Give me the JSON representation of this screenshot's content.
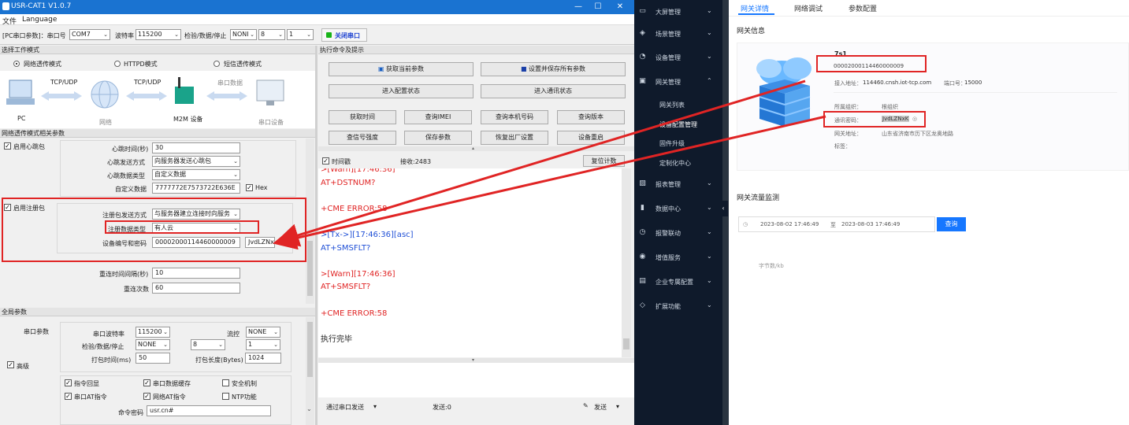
{
  "app": {
    "title": "USR-CAT1 V1.0.7",
    "menu": [
      "文件",
      "Language"
    ],
    "toolbar": {
      "pc_label": "[PC串口参数]：串口号",
      "port": "COM7",
      "baud_label": "波特率",
      "baud": "115200",
      "check_label": "检验/数据/停止",
      "parity": "NONI",
      "databits": "8",
      "stopbits": "1",
      "close_port": "关闭串口"
    },
    "mode_section": "选择工作模式",
    "modes": [
      "网络透传模式",
      "HTTPD模式",
      "短信透传模式"
    ],
    "diagram": {
      "tcp1": "TCP/UDP",
      "tcp2": "TCP/UDP",
      "serial_data": "串口数据",
      "pc": "PC",
      "network": "网络",
      "m2m": "M2M 设备",
      "serial_dev": "串口设备"
    },
    "net_section": "网络透传模式相关参数",
    "heartbeat": {
      "enable": "启用心跳包",
      "interval_label": "心跳时间(秒)",
      "interval": "30",
      "send_label": "心跳发送方式",
      "send": "向服务器发送心跳包",
      "type_label": "心跳数据类型",
      "type": "自定义数据",
      "data_label": "自定义数据",
      "data": "7777772E7573722E636E",
      "hex": "Hex"
    },
    "register": {
      "enable": "启用注册包",
      "send_label": "注册包发送方式",
      "send": "与服务器建立连接时向服务",
      "type_label": "注册数据类型",
      "type": "有人云",
      "id_label": "设备编号和密码",
      "id": "00002000114460000009",
      "pwd": "JvdLZNxK"
    },
    "reconnect_label": "重连时间间隔(秒)",
    "reconnect": "10",
    "retry_label": "重连次数",
    "retry": "60",
    "global_section": "全局参数",
    "serial": {
      "group": "串口参数",
      "baud_label": "串口波特率",
      "baud": "115200",
      "flow_label": "流控",
      "flow": "NONE",
      "check_label": "检验/数据/停止",
      "parity": "NONE",
      "databits": "8",
      "stopbits": "1",
      "pack_time_label": "打包时间(ms)",
      "pack_time": "50",
      "pack_len_label": "打包长度(Bytes)",
      "pack_len": "1024"
    },
    "advanced": "高级",
    "options": [
      "指令回显",
      "串口数据缓存",
      "安全机制",
      "串口AT指令",
      "网络AT指令",
      "NTP功能"
    ],
    "cmd_pwd_label": "命令密码",
    "cmd_pwd": "usr.cn#",
    "exec_section": "执行命令及提示",
    "buttons": [
      "获取当前参数",
      "设置并保存所有参数",
      "进入配置状态",
      "进入通讯状态",
      "获取时间",
      "查询IMEI",
      "查询本机号码",
      "查询版本",
      "查信号强度",
      "保存参数",
      "恢复出厂设置",
      "设备重启"
    ],
    "log_bar": {
      "time_label": "时间戳",
      "recv": "接收:2483",
      "reset": "复位计数"
    },
    "log": [
      {
        "text": ">[Warn][17:46:36]",
        "color": "#e02424"
      },
      {
        "text": "AT+DSTNUM?",
        "color": "#e02424"
      },
      {
        "text": "",
        "color": "#e02424"
      },
      {
        "text": "+CME ERROR:58",
        "color": "#e02424"
      },
      {
        "text": "",
        "color": "#e02424"
      },
      {
        "text": ">[Tx->][17:46:36][asc]",
        "color": "#1f4fd6"
      },
      {
        "text": "AT+SMSFLT?",
        "color": "#1f4fd6"
      },
      {
        "text": "",
        "color": "#e02424"
      },
      {
        "text": ">[Warn][17:46:36]",
        "color": "#e02424"
      },
      {
        "text": "AT+SMSFLT?",
        "color": "#e02424"
      },
      {
        "text": "",
        "color": "#e02424"
      },
      {
        "text": "+CME ERROR:58",
        "color": "#e02424"
      },
      {
        "text": "",
        "color": "#e02424"
      },
      {
        "text": "执行完毕",
        "color": "#222222"
      }
    ],
    "bottom": {
      "send_via": "通过串口发送",
      "sent": "发送:0",
      "send": "发送"
    }
  },
  "web": {
    "nav": [
      {
        "label": "大屏管理",
        "icon": "screen-icon"
      },
      {
        "label": "场景管理",
        "icon": "scene-icon"
      },
      {
        "label": "设备管理",
        "icon": "device-icon"
      },
      {
        "label": "网关管理",
        "icon": "gateway-icon"
      },
      {
        "label": "报表管理",
        "icon": "report-icon"
      },
      {
        "label": "数据中心",
        "icon": "data-icon"
      },
      {
        "label": "报警联动",
        "icon": "alarm-icon"
      },
      {
        "label": "增值服务",
        "icon": "service-icon"
      },
      {
        "label": "企业专属配置",
        "icon": "enterprise-icon"
      },
      {
        "label": "扩展功能",
        "icon": "extend-icon"
      }
    ],
    "subnav": [
      "网关列表",
      "设备配置管理",
      "固件升级",
      "定制化中心"
    ],
    "tabs": [
      "网关详情",
      "网络调试",
      "参数配置"
    ],
    "gateway_info_title": "网关信息",
    "gw_name": "7s1",
    "gw_sn": "00002000114460000009",
    "access_label": "接入地址：",
    "access": "114460.cnsh.iot-tcp.com",
    "port_label": "端口号：",
    "port": "15000",
    "org_label": "所属组织：",
    "org": "根组织",
    "pwd_label": "通讯密码：",
    "pwd": "JvdLZNxK",
    "addr_label": "网关地址：",
    "addr": "山东省济南市历下区龙奥地路",
    "tag_label": "标签：",
    "traffic_title": "网关流量监测",
    "date_from": "2023-08-02 17:46:49",
    "date_to_label": "至",
    "date_to": "2023-08-03 17:46:49",
    "query": "查询",
    "unit": "字节数/kb"
  }
}
